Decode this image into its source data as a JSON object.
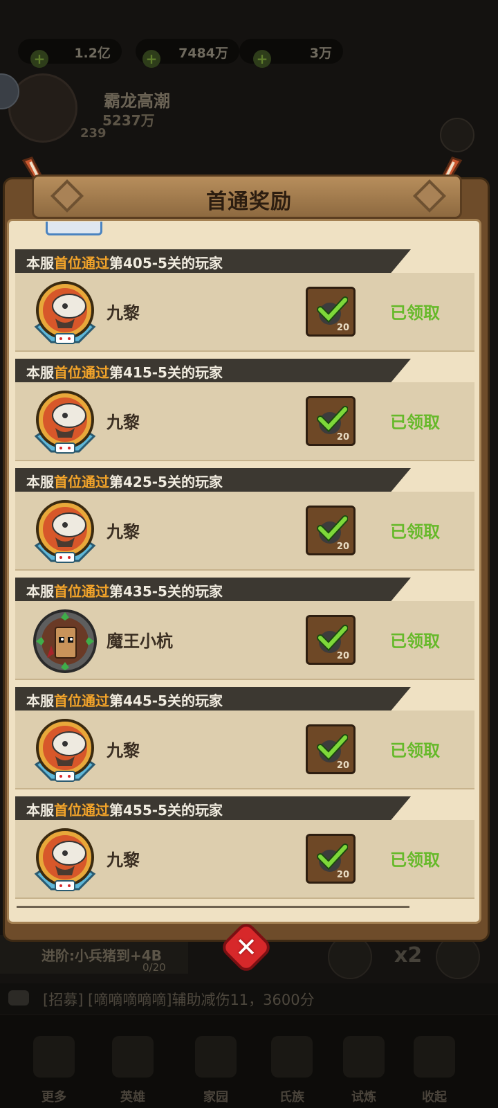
{
  "background": {
    "resources": [
      "1.2亿",
      "7484万",
      "3万"
    ],
    "player_name": "霸龙高潮",
    "player_power": "5237万",
    "player_level": "239",
    "quest_text": "进阶:小兵猪到+4B",
    "quest_count": "0/20",
    "speed_label": "x2",
    "chat_text": "[招募] [嘀嘀嘀嘀嘀]辅助减伤11，3600分",
    "nav": [
      "更多",
      "英雄",
      "家园",
      "氏族",
      "试炼",
      "收起"
    ]
  },
  "modal": {
    "title": "首通奖励",
    "close_label": "✕",
    "rows": [
      {
        "prefix": "本服",
        "highlight": "首位通过",
        "suffix": "第405-5关的玩家",
        "player": "九黎",
        "avatar": "skull-warrior",
        "reward_count": "20",
        "status": "已领取"
      },
      {
        "prefix": "本服",
        "highlight": "首位通过",
        "suffix": "第415-5关的玩家",
        "player": "九黎",
        "avatar": "skull-warrior",
        "reward_count": "20",
        "status": "已领取"
      },
      {
        "prefix": "本服",
        "highlight": "首位通过",
        "suffix": "第425-5关的玩家",
        "player": "九黎",
        "avatar": "skull-warrior",
        "reward_count": "20",
        "status": "已领取"
      },
      {
        "prefix": "本服",
        "highlight": "首位通过",
        "suffix": "第435-5关的玩家",
        "player": "魔王小杭",
        "avatar": "tribal-mask",
        "reward_count": "20",
        "status": "已领取"
      },
      {
        "prefix": "本服",
        "highlight": "首位通过",
        "suffix": "第445-5关的玩家",
        "player": "九黎",
        "avatar": "skull-warrior",
        "reward_count": "20",
        "status": "已领取"
      },
      {
        "prefix": "本服",
        "highlight": "首位通过",
        "suffix": "第455-5关的玩家",
        "player": "九黎",
        "avatar": "skull-warrior",
        "reward_count": "20",
        "status": "已领取"
      }
    ]
  },
  "colors": {
    "claimed_green": "#66b92a",
    "highlight_orange": "#f3a42a",
    "header_bar": "#3c3831",
    "card_bg": "#ddceae"
  }
}
